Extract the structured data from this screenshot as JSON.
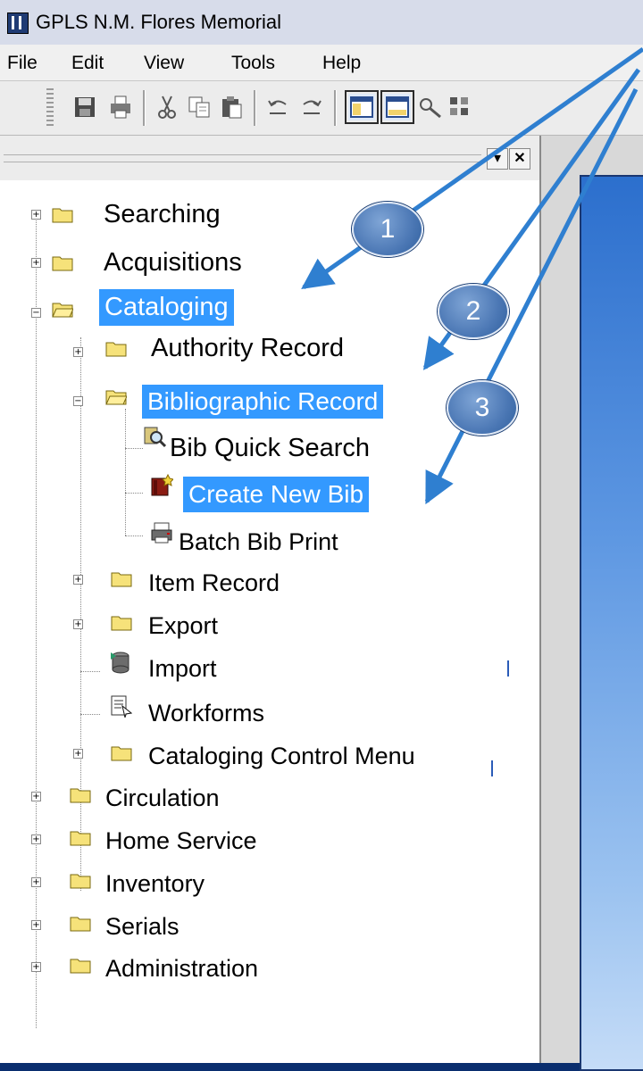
{
  "window": {
    "title": "GPLS N.M. Flores Memorial"
  },
  "menubar": {
    "items": [
      "File",
      "Edit",
      "View",
      "Tools",
      "Help"
    ]
  },
  "toolbar": {
    "icons": [
      "save-icon",
      "print-icon",
      "cut-icon",
      "copy-icon",
      "paste-icon",
      "undo-icon",
      "redo-icon",
      "toggle-panel-icon",
      "dock-panel-icon",
      "tool-icon",
      "grid-icon"
    ]
  },
  "panel": {
    "pin_glyph": "▾",
    "close_glyph": "✕"
  },
  "tree": {
    "searching": "Searching",
    "acquisitions": "Acquisitions",
    "cataloging": "Cataloging",
    "authority_record": "Authority Record",
    "bibliographic_record": "Bibliographic Record",
    "bib_quick_search": "Bib Quick Search",
    "create_new_bib": "Create New Bib",
    "batch_bib_print": "Batch Bib Print",
    "item_record": "Item Record",
    "export": "Export",
    "import": "Import",
    "workforms": "Workforms",
    "cataloging_control_menu": "Cataloging Control Menu",
    "circulation": "Circulation",
    "home_service": "Home Service",
    "inventory": "Inventory",
    "serials": "Serials",
    "administration": "Administration"
  },
  "callouts": [
    "1",
    "2",
    "3"
  ],
  "colors": {
    "selection": "#3399ff",
    "callout_fill": "#4c78b5",
    "arrow": "#2f7fd0",
    "background": "#1d4fa3"
  }
}
